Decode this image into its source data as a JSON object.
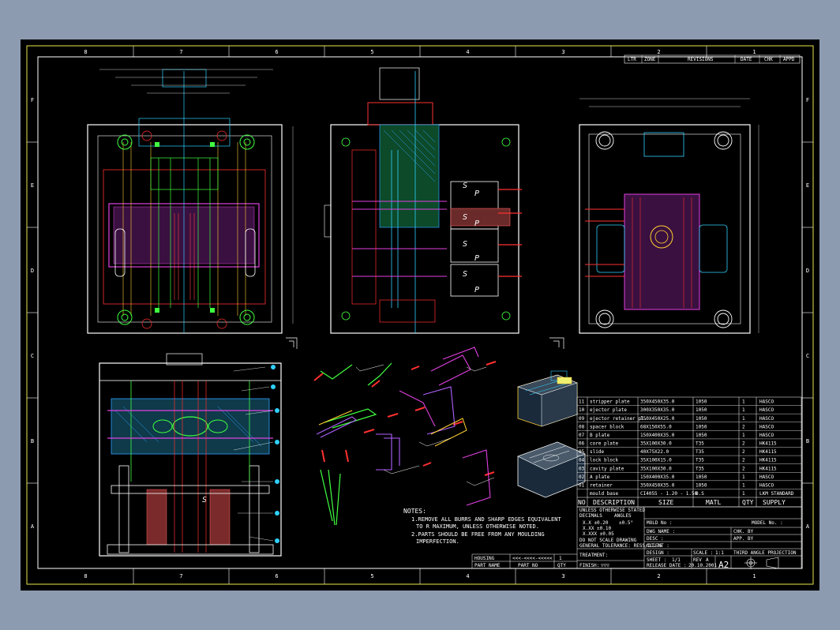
{
  "zones": {
    "columns": [
      "8",
      "7",
      "6",
      "5",
      "4",
      "3",
      "2",
      "1"
    ],
    "rows": [
      "F",
      "E",
      "D",
      "C",
      "B",
      "A"
    ]
  },
  "revision_block": {
    "headers": [
      "LTR",
      "ZONE",
      "REVISIONS",
      "DATE",
      "CHK",
      "APPD"
    ]
  },
  "section_marks": [
    "S",
    "P",
    "S",
    "P",
    "S",
    "P",
    "S",
    "P"
  ],
  "bom": {
    "columns": [
      "NO",
      "DESCRIPTION",
      "SIZE",
      "MATL",
      "QTY",
      "SUPPLY"
    ],
    "rows": [
      {
        "no": "11",
        "desc": "stripper plate",
        "size": "350X450X35.0",
        "matl": "1050",
        "qty": "1",
        "supply": "HASCO"
      },
      {
        "no": "10",
        "desc": "ejector plate",
        "size": "300X350X35.0",
        "matl": "1050",
        "qty": "1",
        "supply": "HASCO"
      },
      {
        "no": "09",
        "desc": "ejector retainer pl.",
        "size": "350X450X25.0",
        "matl": "1050",
        "qty": "1",
        "supply": "HASCO"
      },
      {
        "no": "08",
        "desc": "spacer block",
        "size": "68X150X55.0",
        "matl": "1050",
        "qty": "2",
        "supply": "HASCO"
      },
      {
        "no": "07",
        "desc": "B plate",
        "size": "150X400X35.0",
        "matl": "1050",
        "qty": "1",
        "supply": "HASCO"
      },
      {
        "no": "06",
        "desc": "core plate",
        "size": "35X100X30.0",
        "matl": "T35",
        "qty": "2",
        "supply": "HK4115"
      },
      {
        "no": "05",
        "desc": "slide",
        "size": "40X75X22.0",
        "matl": "T35",
        "qty": "2",
        "supply": "HK4115"
      },
      {
        "no": "04",
        "desc": "lock block",
        "size": "35X100X15.0",
        "matl": "T35",
        "qty": "2",
        "supply": "HK4115"
      },
      {
        "no": "03",
        "desc": "cavity plate",
        "size": "35X100X30.0",
        "matl": "T35",
        "qty": "2",
        "supply": "HK4115"
      },
      {
        "no": "02",
        "desc": "A plate",
        "size": "150X400X35.0",
        "matl": "1050",
        "qty": "1",
        "supply": "HASCO"
      },
      {
        "no": "01",
        "desc": "retainer",
        "size": "350X450X35.0",
        "matl": "1050",
        "qty": "1",
        "supply": "HASCO"
      },
      {
        "no": "",
        "desc": "mould base",
        "size": "CI4055 - 1.20 - 1.50",
        "matl": "B.S",
        "qty": "1",
        "supply": "LKM STANDARD"
      }
    ]
  },
  "notes": {
    "title": "NOTES:",
    "lines": [
      "1.REMOVE ALL BURRS AND SHARP EDGES EQUIVALENT",
      "TO  R MAXIMUM, UNLESS OTHERWISE NOTED.",
      "2.PARTS SHOULD BE FREE FROM ANY MOULDING",
      "IMPERFECTION."
    ]
  },
  "title_block": {
    "tolerance_header": [
      "UNLESS OTHERWISE STATED",
      "DECIMALS",
      "ANGLES"
    ],
    "tolerances": [
      "X.X ±0.20",
      "X.XX ±0.10",
      "X.XXX ±0.05",
      "±0.5°"
    ],
    "do_not_scale": "DO NOT SCALE DRAWING",
    "general_tol": "GENERAL TOLERANCE: RESS/DI.75",
    "treatment": "TREATMENT:",
    "finish": "FINISH:",
    "finish_symbol": "▽▽▽",
    "housing_row": [
      "HOUSING",
      "<<<-<<<<-<<<<<",
      "1"
    ],
    "part_row": [
      "PART NAME",
      "PART NO",
      "QTY"
    ],
    "mold_no": "MOLD No :",
    "dwg_name": "DWG NAME :",
    "desc": "DESC :",
    "client": "CLIENT :",
    "dsgn_label": "DESIGN :",
    "dsgn_value": "",
    "scale_label": "SCALE :",
    "scale_value": "1:1",
    "sheet_label": "SHEET :",
    "sheet_value": "1/1",
    "rev_label": "REV",
    "rev_value": "A",
    "release_label": "RELEASE DATE :",
    "release_value": "20.10.2001",
    "size_value": "A2",
    "chk": "CHK. BY",
    "app": "APP. BY",
    "model_no": "MODEL No. :",
    "projection": "THIRD ANGLE PROJECTION"
  }
}
